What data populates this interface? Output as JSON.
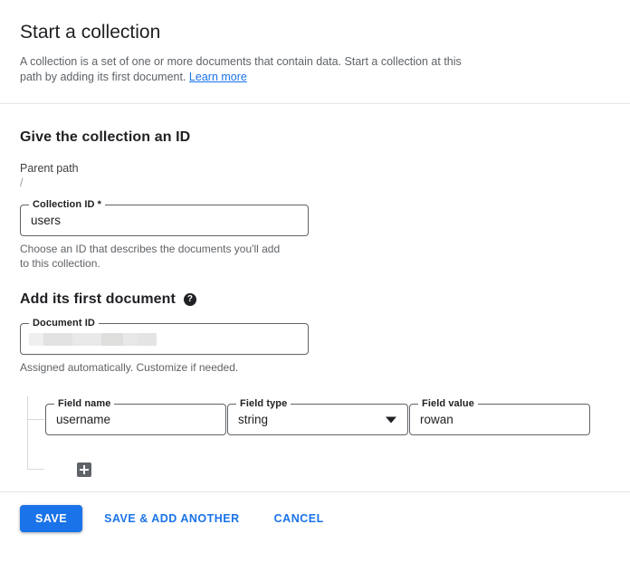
{
  "dialog": {
    "title": "Start a collection",
    "description_part1": "A collection is a set of one or more documents that contain data. Start a collection at this path by adding its first document.",
    "learn_more_label": "Learn more"
  },
  "collection_section": {
    "heading": "Give the collection an ID",
    "parent_path_label": "Parent path",
    "parent_path_value": "/",
    "collection_id_label": "Collection ID *",
    "collection_id_value": "users",
    "collection_id_helper": "Choose an ID that describes the documents you'll add to this collection."
  },
  "document_section": {
    "heading": "Add its first document",
    "help_icon_glyph": "?",
    "document_id_label": "Document ID",
    "document_id_value": "",
    "document_id_helper": "Assigned automatically. Customize if needed."
  },
  "field_row": {
    "field_name_label": "Field name",
    "field_name_value": "username",
    "field_type_label": "Field type",
    "field_type_value": "string",
    "field_value_label": "Field value",
    "field_value_value": "rowan"
  },
  "actions": {
    "save_label": "SAVE",
    "save_and_add_another_label": "SAVE & ADD ANOTHER",
    "cancel_label": "CANCEL"
  },
  "colors": {
    "accent": "#1a73e8",
    "text_primary": "#202124",
    "text_secondary": "#5f6368",
    "divider": "#e4e6e8",
    "field_border": "#5f6368"
  }
}
